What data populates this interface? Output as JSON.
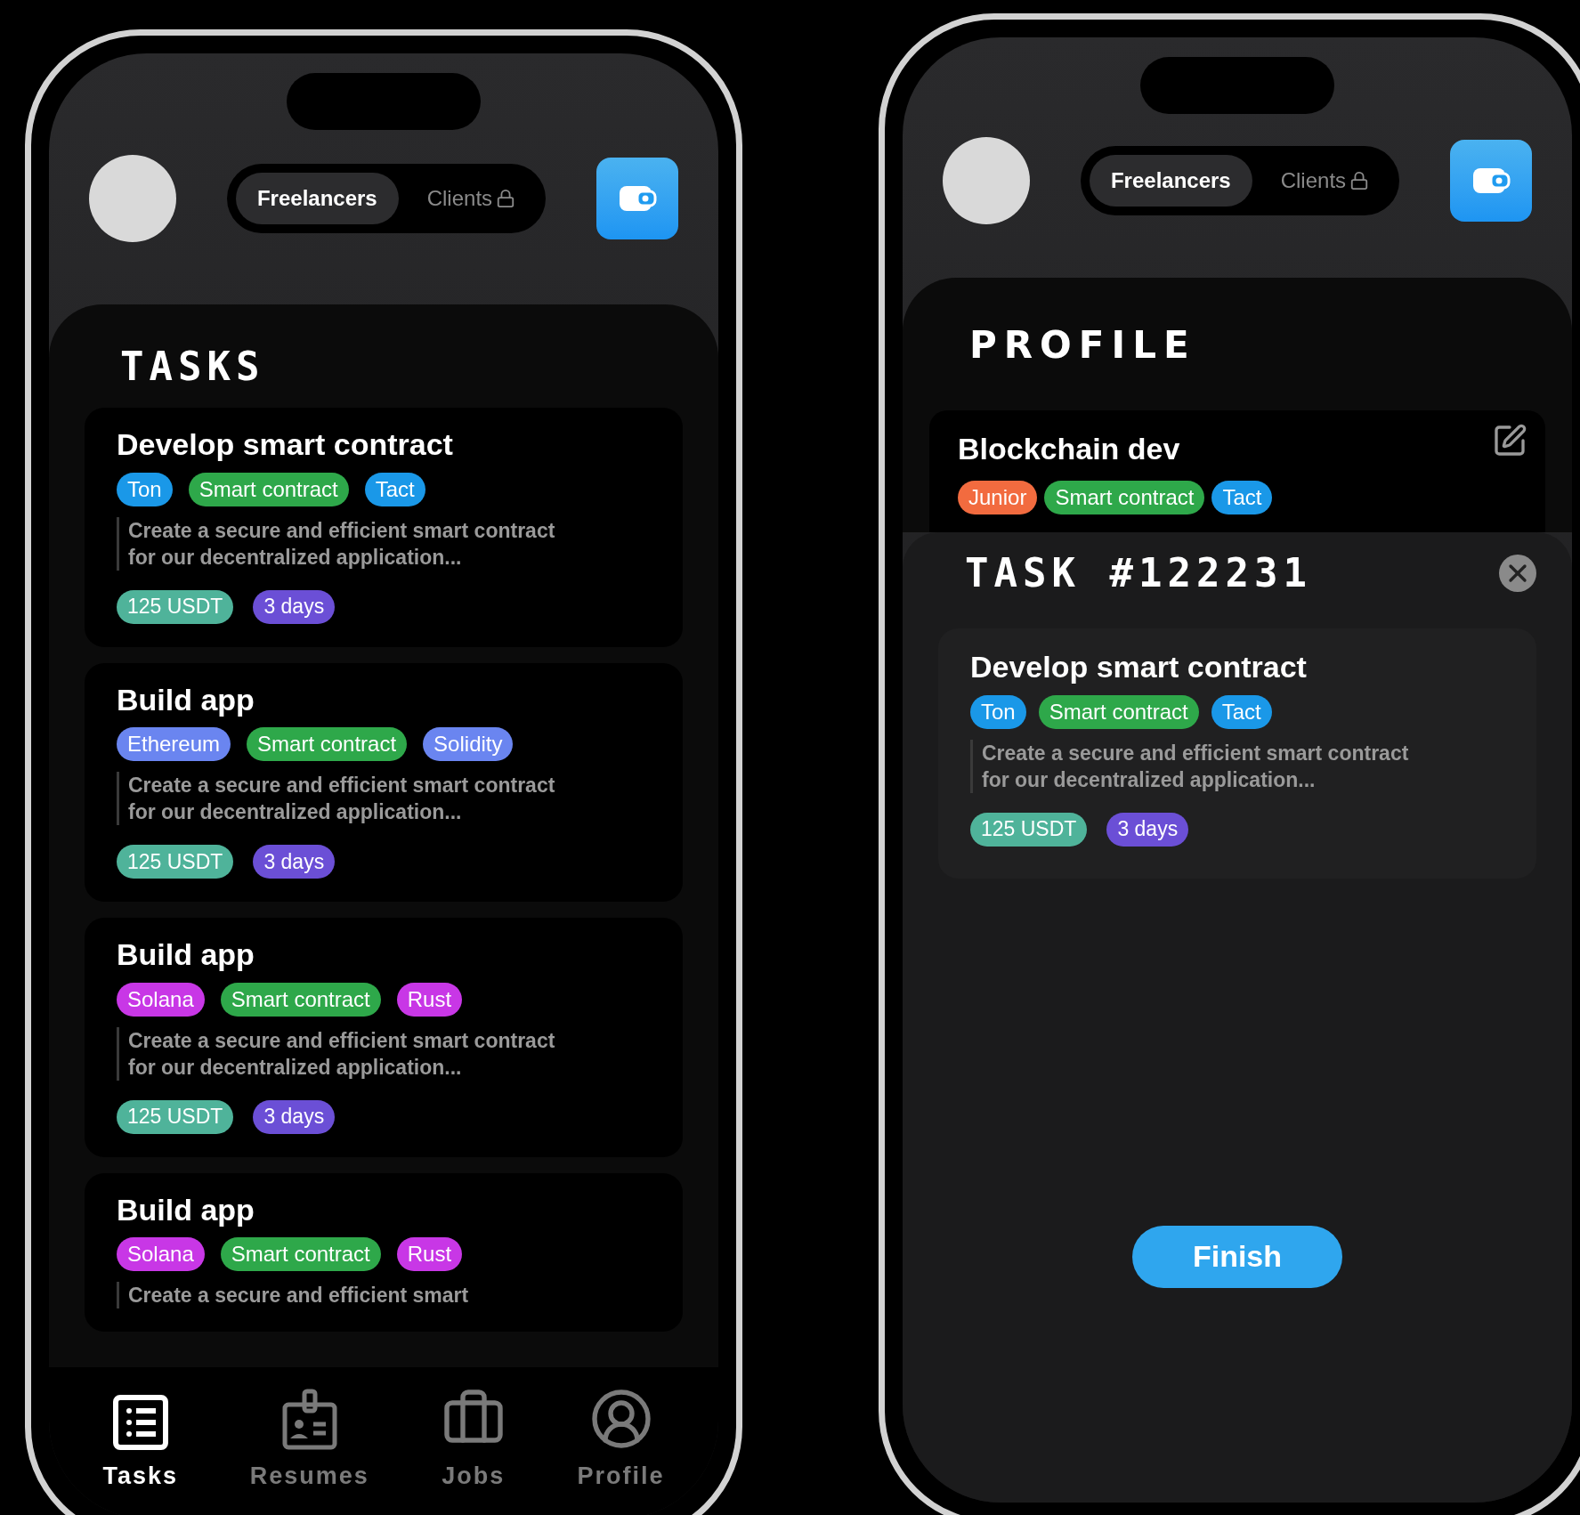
{
  "tasks_phone": {
    "header": {
      "toggle": [
        {
          "label": "Freelancers",
          "selected": true,
          "locked": false
        },
        {
          "label": "Clients",
          "selected": false,
          "locked": true
        }
      ]
    },
    "title": "TASKS",
    "tasks": [
      {
        "title": "Develop smart contract",
        "tags": [
          {
            "label": "Ton",
            "color": "#1a98e8"
          },
          {
            "label": "Smart contract",
            "color": "#2ea84a"
          },
          {
            "label": "Tact",
            "color": "#1a98e8"
          }
        ],
        "description": "Create a secure and efficient smart contract for our decentralized application...",
        "price": "125 USDT",
        "duration": "3 days"
      },
      {
        "title": "Build app",
        "tags": [
          {
            "label": "Ethereum",
            "color": "#6a85f0"
          },
          {
            "label": "Smart contract",
            "color": "#2ea84a"
          },
          {
            "label": "Solidity",
            "color": "#6a85f0"
          }
        ],
        "description": "Create a secure and efficient smart contract for our decentralized application...",
        "price": "125 USDT",
        "duration": "3 days"
      },
      {
        "title": "Build app",
        "tags": [
          {
            "label": "Solana",
            "color": "#c837e6"
          },
          {
            "label": "Smart contract",
            "color": "#2ea84a"
          },
          {
            "label": "Rust",
            "color": "#c837e6"
          }
        ],
        "description": "Create a secure and efficient smart contract for our decentralized application...",
        "price": "125 USDT",
        "duration": "3 days"
      },
      {
        "title": "Build app",
        "tags": [
          {
            "label": "Solana",
            "color": "#c837e6"
          },
          {
            "label": "Smart contract",
            "color": "#2ea84a"
          },
          {
            "label": "Rust",
            "color": "#c837e6"
          }
        ],
        "description": "Create a secure and efficient smart"
      }
    ],
    "nav": [
      {
        "kind": "tasks",
        "label": "Tasks",
        "selected": true
      },
      {
        "kind": "resumes",
        "label": "Resumes",
        "selected": false
      },
      {
        "kind": "jobs",
        "label": "Jobs",
        "selected": false
      },
      {
        "kind": "profile",
        "label": "Profile",
        "selected": false
      }
    ]
  },
  "detail_phone": {
    "header": {
      "toggle": [
        {
          "label": "Freelancers",
          "selected": true,
          "locked": false
        },
        {
          "label": "Clients",
          "selected": false,
          "locked": true
        }
      ]
    },
    "title": "PROFILE",
    "profile_card": {
      "title": "Blockchain dev",
      "tags": [
        {
          "label": "Junior",
          "color": "#f26b3f"
        },
        {
          "label": "Smart contract",
          "color": "#2ea84a"
        },
        {
          "label": "Tact",
          "color": "#1a98e8"
        }
      ]
    },
    "modal": {
      "title": "TASK #122231",
      "task": {
        "title": "Develop smart contract",
        "tags": [
          {
            "label": "Ton",
            "color": "#1a98e8"
          },
          {
            "label": "Smart contract",
            "color": "#2ea84a"
          },
          {
            "label": "Tact",
            "color": "#1a98e8"
          }
        ],
        "description": "Create a secure and efficient smart contract for our decentralized application...",
        "price": "125 USDT",
        "duration": "3 days"
      },
      "button": "Finish"
    }
  }
}
